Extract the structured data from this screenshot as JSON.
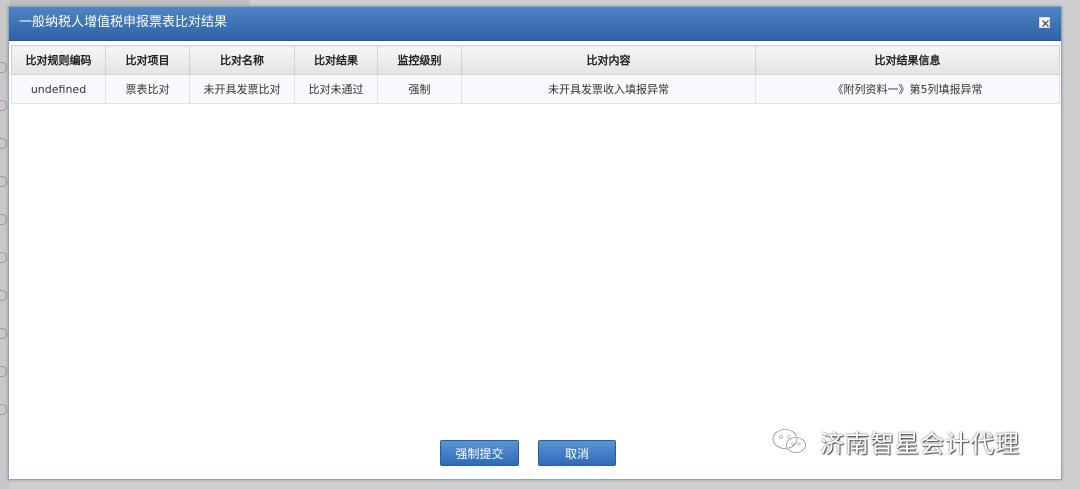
{
  "dialog": {
    "title": "一般纳税人增值税申报票表比对结果"
  },
  "table": {
    "headers": [
      "比对规则编码",
      "比对项目",
      "比对名称",
      "比对结果",
      "监控级别",
      "比对内容",
      "比对结果信息"
    ],
    "rows": [
      [
        "undefined",
        "票表比对",
        "未开具发票比对",
        "比对未通过",
        "强制",
        "未开具发票收入填报异常",
        "《附列资料一》第5列填报异常"
      ]
    ]
  },
  "buttons": {
    "force_submit": "强制提交",
    "cancel": "取消"
  },
  "watermark": {
    "text": "济南智星会计代理"
  },
  "colors": {
    "title_bar": "#3a6fb3",
    "button": "#3d7cc9"
  }
}
